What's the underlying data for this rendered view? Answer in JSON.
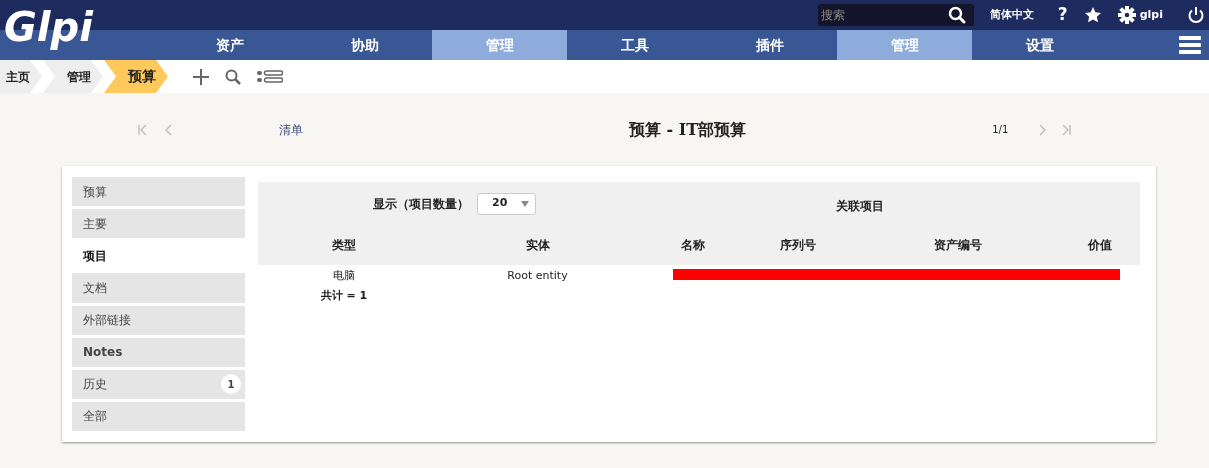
{
  "header": {
    "logo": "Glpi",
    "search": {
      "placeholder": "搜索"
    },
    "language": "简体中文",
    "help": "?",
    "user": "glpi"
  },
  "menu": [
    {
      "label": "资产",
      "selected": false
    },
    {
      "label": "协助",
      "selected": false
    },
    {
      "label": "管理",
      "selected": true
    },
    {
      "label": "工具",
      "selected": false
    },
    {
      "label": "插件",
      "selected": false
    },
    {
      "label": "管理",
      "selected": true
    },
    {
      "label": "设置",
      "selected": false
    }
  ],
  "breadcrumb": [
    {
      "label": "主页",
      "selected": false
    },
    {
      "label": "管理",
      "selected": false
    },
    {
      "label": "预算",
      "selected": true
    }
  ],
  "record_nav": {
    "list_link": "清单",
    "title": "预算 - IT部预算",
    "counter": "1/1"
  },
  "tabs": [
    {
      "label": "预算",
      "selected": false
    },
    {
      "label": "主要",
      "selected": false
    },
    {
      "label": "项目",
      "selected": true
    },
    {
      "label": "文档",
      "selected": false
    },
    {
      "label": "外部链接",
      "selected": false
    },
    {
      "label": "Notes",
      "selected": false
    },
    {
      "label": "历史",
      "selected": false,
      "badge": "1"
    },
    {
      "label": "全部",
      "selected": false
    }
  ],
  "items_table": {
    "display_label": "显示（项目数量）",
    "page_size": "20",
    "caption": "关联项目",
    "columns": [
      "类型",
      "实体",
      "名称",
      "序列号",
      "资产编号",
      "价值"
    ],
    "rows": [
      {
        "cells": [
          "电脑",
          "Root entity"
        ],
        "redacted": true
      }
    ],
    "total": "共计 = 1"
  }
}
